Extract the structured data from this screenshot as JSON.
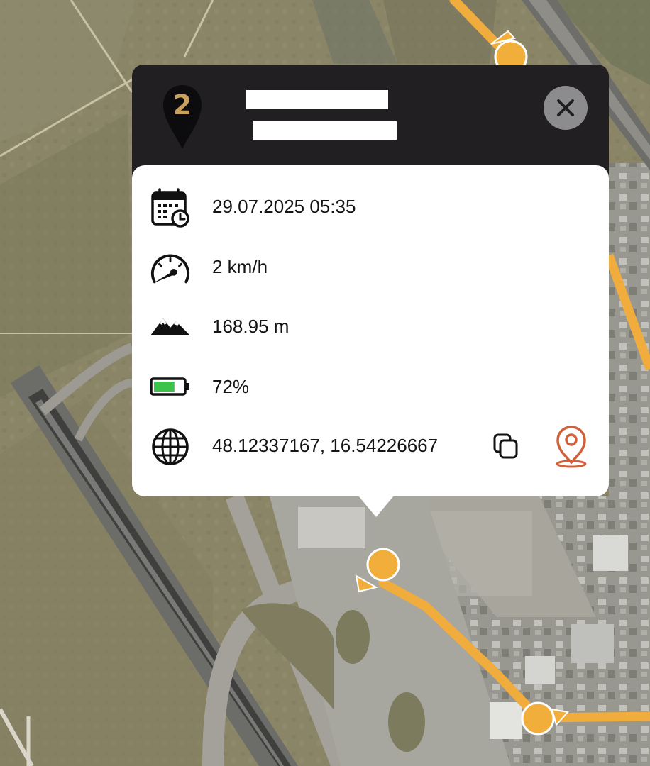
{
  "map": {
    "route_color": "#f0ac3c",
    "marker_color": "#f2ae3a"
  },
  "popup": {
    "marker_number": "2",
    "marker_icon": "map-pin-badge",
    "close_icon": "close-x",
    "header_color": "#221f23",
    "rows": [
      {
        "icon": "calendar-clock-icon",
        "value": "29.07.2025 05:35"
      },
      {
        "icon": "speedometer-icon",
        "value": "2 km/h"
      },
      {
        "icon": "mountain-icon",
        "value": "168.95 m"
      },
      {
        "icon": "battery-icon",
        "value": "72%"
      },
      {
        "icon": "globe-icon",
        "value": "48.12337167, 16.54226667"
      }
    ],
    "battery_level": 0.72,
    "copy_icon": "copy-icon",
    "locate_icon": "location-pin-icon",
    "locate_color": "#d0603a"
  }
}
